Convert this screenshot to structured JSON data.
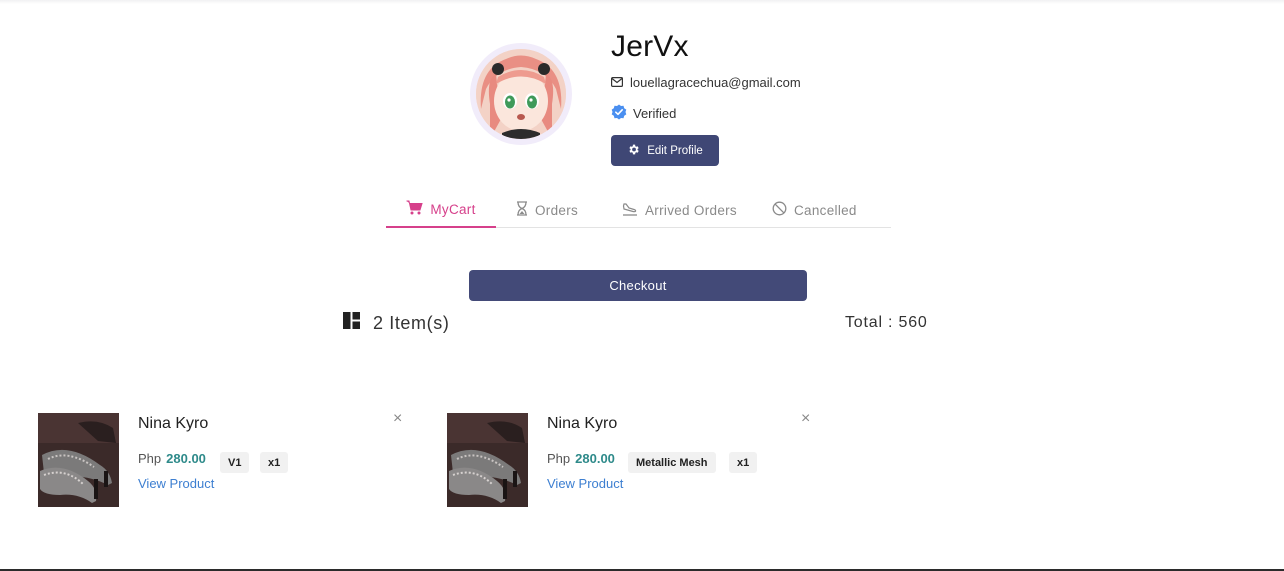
{
  "profile": {
    "username": "JerVx",
    "email": "louellagracechua@gmail.com",
    "verified_label": "Verified",
    "edit_button_label": "Edit Profile"
  },
  "tabs": [
    {
      "label": "MyCart",
      "icon": "cart-icon",
      "active": true
    },
    {
      "label": "Orders",
      "icon": "hourglass-icon",
      "active": false
    },
    {
      "label": "Arrived Orders",
      "icon": "plane-landing-icon",
      "active": false
    },
    {
      "label": "Cancelled",
      "icon": "ban-icon",
      "active": false
    }
  ],
  "cart": {
    "checkout_label": "Checkout",
    "items_count_label": "2 Item(s)",
    "total_label": "Total : 560",
    "items": [
      {
        "name": "Nina Kyro",
        "currency": "Php",
        "price": "280.00",
        "variant": "V1",
        "quantity": "x1",
        "link_label": "View Product"
      },
      {
        "name": "Nina Kyro",
        "currency": "Php",
        "price": "280.00",
        "variant": "Metallic Mesh",
        "quantity": "x1",
        "link_label": "View Product"
      }
    ]
  },
  "colors": {
    "accent_pink": "#d6408b",
    "button_navy": "#3f4775",
    "price_teal": "#2e8a8a",
    "link_blue": "#3d7fd1",
    "verified_blue": "#4a8ff0"
  }
}
